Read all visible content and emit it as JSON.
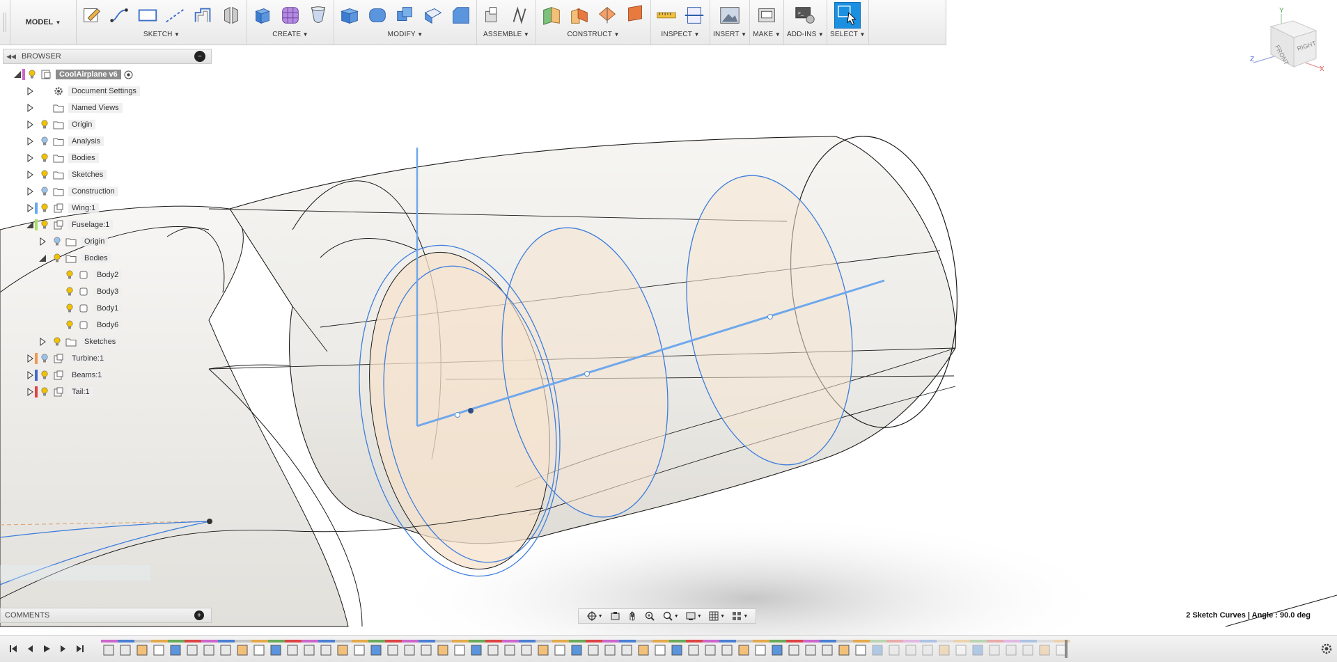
{
  "app": {
    "workspace_label": "MODEL"
  },
  "toolbar": {
    "groups": [
      {
        "label": "SKETCH",
        "icons": [
          "create-sketch-icon",
          "line-icon",
          "rectangle-icon",
          "construction-line-icon",
          "offset-icon",
          "mirror-icon"
        ]
      },
      {
        "label": "CREATE",
        "icons": [
          "extrude-icon",
          "form-icon",
          "revolve-icon"
        ]
      },
      {
        "label": "MODIFY",
        "icons": [
          "press-pull-icon",
          "fillet-icon",
          "combine-icon",
          "shell-icon",
          "chamfer-icon"
        ]
      },
      {
        "label": "ASSEMBLE",
        "icons": [
          "new-component-icon",
          "joint-icon"
        ]
      },
      {
        "label": "CONSTRUCT",
        "icons": [
          "offset-plane-icon",
          "plane-at-angle-icon",
          "midplane-icon",
          "tangent-plane-icon"
        ]
      },
      {
        "label": "INSPECT",
        "icons": [
          "measure-icon",
          "section-analysis-icon"
        ]
      },
      {
        "label": "INSERT",
        "icons": [
          "insert-image-icon"
        ]
      },
      {
        "label": "MAKE",
        "icons": [
          "print-3d-icon"
        ]
      },
      {
        "label": "ADD-INS",
        "icons": [
          "scripts-icon"
        ]
      },
      {
        "label": "SELECT",
        "icons": [
          "select-icon"
        ]
      }
    ]
  },
  "browser": {
    "title": "BROWSER",
    "items": [
      {
        "label": "CoolAirplane v6",
        "level": 0,
        "expand": "open",
        "bar": "#cc66cc",
        "icon": "document-icon",
        "root": true
      },
      {
        "label": "Document Settings",
        "level": 1,
        "expand": "closed",
        "icon": "gear-icon",
        "bulb": false
      },
      {
        "label": "Named Views",
        "level": 1,
        "expand": "closed",
        "icon": "folder-icon",
        "bulb": false
      },
      {
        "label": "Origin",
        "level": 1,
        "expand": "closed",
        "icon": "folder-icon",
        "bulb": "on"
      },
      {
        "label": "Analysis",
        "level": 1,
        "expand": "closed",
        "icon": "folder-icon",
        "bulb": "off"
      },
      {
        "label": "Bodies",
        "level": 1,
        "expand": "closed",
        "icon": "folder-icon",
        "bulb": "on"
      },
      {
        "label": "Sketches",
        "level": 1,
        "expand": "closed",
        "icon": "folder-icon",
        "bulb": "on"
      },
      {
        "label": "Construction",
        "level": 1,
        "expand": "closed",
        "icon": "folder-icon",
        "bulb": "off"
      },
      {
        "label": "Wing:1",
        "level": 1,
        "expand": "closed",
        "icon": "component-icon",
        "bulb": "on",
        "bar": "#66aaee"
      },
      {
        "label": "Fuselage:1",
        "level": 1,
        "expand": "open",
        "icon": "component-icon",
        "bulb": "on",
        "bar": "#aadd66"
      },
      {
        "label": "Origin",
        "level": 2,
        "expand": "closed",
        "icon": "folder-icon",
        "bulb": "off"
      },
      {
        "label": "Bodies",
        "level": 2,
        "expand": "open",
        "icon": "folder-icon",
        "bulb": "on"
      },
      {
        "label": "Body2",
        "level": 3,
        "expand": "none",
        "icon": "body-icon",
        "bulb": "on"
      },
      {
        "label": "Body3",
        "level": 3,
        "expand": "none",
        "icon": "body-icon",
        "bulb": "on"
      },
      {
        "label": "Body1",
        "level": 3,
        "expand": "none",
        "icon": "body-icon",
        "bulb": "on"
      },
      {
        "label": "Body6",
        "level": 3,
        "expand": "none",
        "icon": "body-icon",
        "bulb": "on"
      },
      {
        "label": "Sketches",
        "level": 2,
        "expand": "closed",
        "icon": "folder-icon",
        "bulb": "on"
      },
      {
        "label": "Turbine:1",
        "level": 1,
        "expand": "closed",
        "icon": "component-icon",
        "bulb": "off",
        "bar": "#ee9955"
      },
      {
        "label": "Beams:1",
        "level": 1,
        "expand": "closed",
        "icon": "component-icon",
        "bulb": "on",
        "bar": "#4466cc"
      },
      {
        "label": "Tail:1",
        "level": 1,
        "expand": "closed",
        "icon": "component-icon",
        "bulb": "on",
        "bar": "#dd4444"
      }
    ]
  },
  "comments": {
    "title": "COMMENTS"
  },
  "status": {
    "text": "2 Sketch Curves | Angle : 90.0 deg"
  },
  "viewcube": {
    "faces": [
      "FRONT",
      "RIGHT"
    ],
    "axes": [
      "X",
      "Y",
      "Z"
    ]
  },
  "navbar": {
    "icons": [
      "orbit-icon",
      "look-at-icon",
      "pan-icon",
      "zoom-window-icon",
      "zoom-icon",
      "display-settings-icon",
      "grid-icon",
      "viewports-icon"
    ]
  },
  "colors": {
    "accent": "#1b8fe0",
    "sketch_blue": "#3c7ddc",
    "axis_blue": "#6fa8ec",
    "body_tint": "#f5e5d2"
  }
}
